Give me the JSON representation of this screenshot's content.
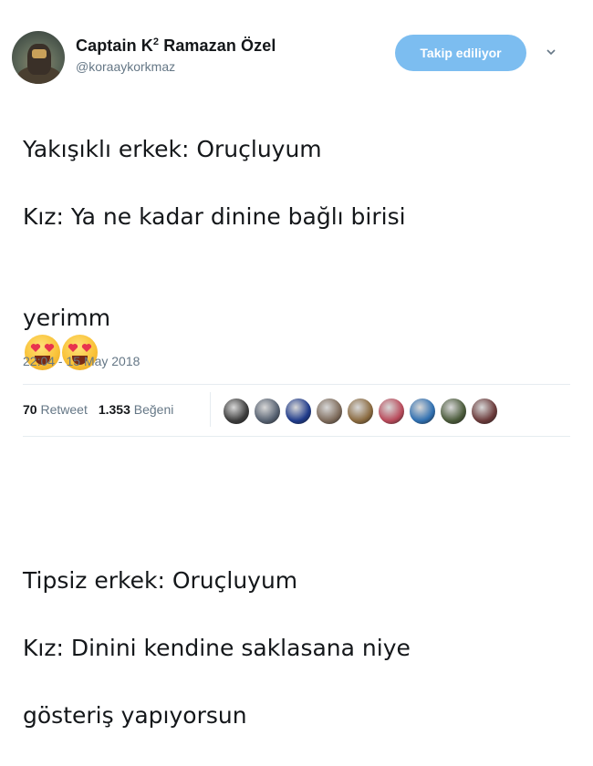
{
  "author": {
    "display_name": "Captain K",
    "display_name_sup": "2",
    "display_name_rest": " Ramazan Özel",
    "handle": "@koraaykorkmaz",
    "follow_label": "Takip ediliyor"
  },
  "tweet": {
    "line1": "Yakışıklı erkek: Oruçluyum",
    "line2": "Kız: Ya ne kadar dinine bağlı birisi",
    "line3": "yerimm",
    "line4": "Tipsiz erkek: Oruçluyum",
    "line5": "Kız: Dinini kendine saklasana niye",
    "line6": "gösteriş yapıyorsun",
    "emoji": "smiling-face-with-heart-eyes"
  },
  "timestamp": "22:04 - 15 May 2018",
  "stats": {
    "retweet_count": "70",
    "retweet_label": "Retweet",
    "like_count": "1.353",
    "like_label": "Beğeni"
  },
  "likers_colors": [
    "#3b3b3b",
    "#556070",
    "#1e3a8a",
    "#7d6a5a",
    "#8a6a3f",
    "#b84a5a",
    "#2f6fb0",
    "#4a5a3a",
    "#6a3a3a"
  ]
}
